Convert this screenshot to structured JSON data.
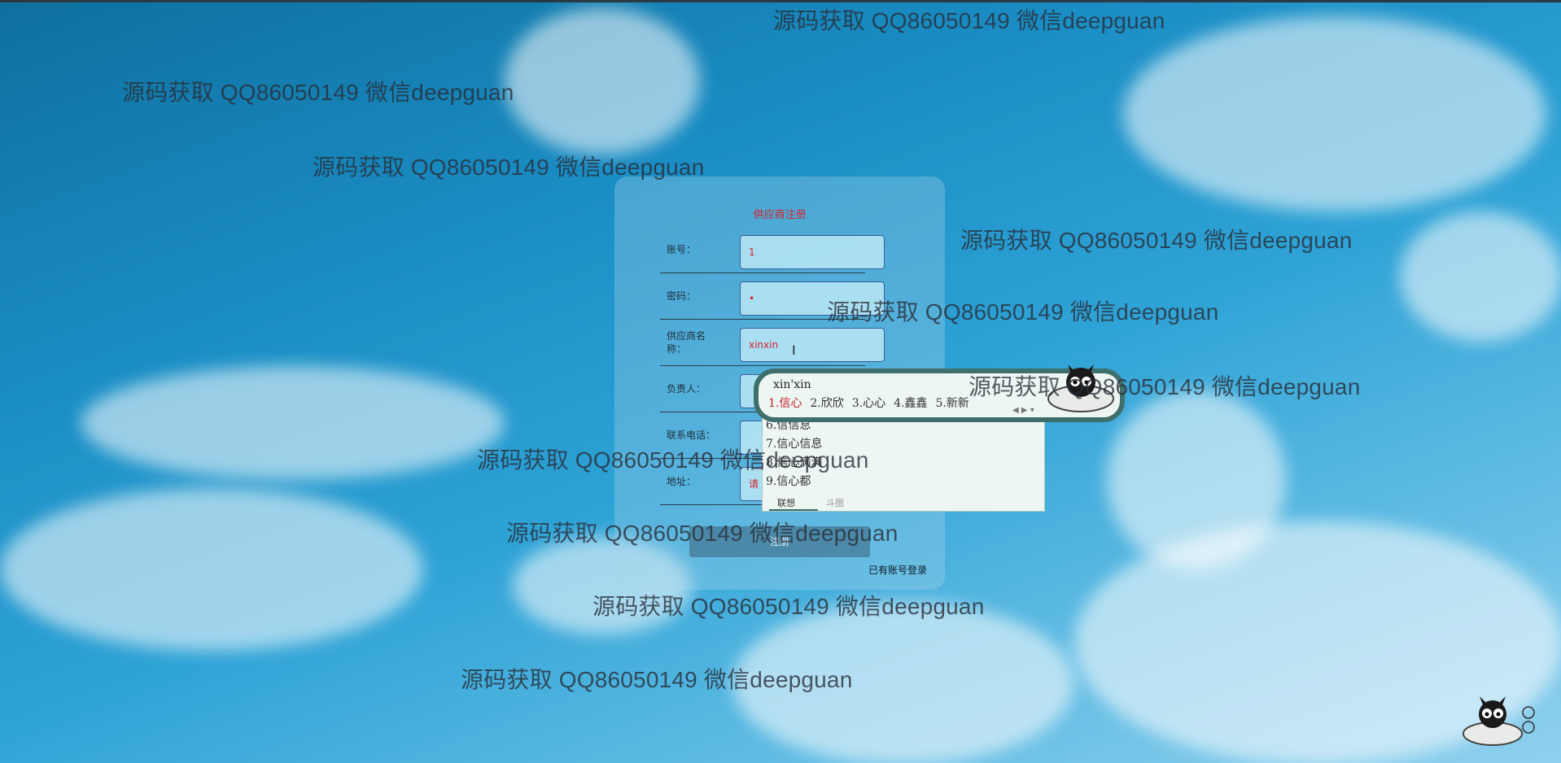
{
  "watermark_text": "源码获取 QQ86050149 微信deepguan",
  "form": {
    "title": "供应商注册",
    "fields": [
      {
        "label": "账号：",
        "value": "1"
      },
      {
        "label": "密码：",
        "value": "•"
      },
      {
        "label": "供应商名称：",
        "value": "xinxin"
      },
      {
        "label": "负责人：",
        "value": ""
      },
      {
        "label": "联系电话：",
        "value": ""
      },
      {
        "label": "地址：",
        "value": "请"
      }
    ],
    "register_button": "注册",
    "login_link": "已有账号登录"
  },
  "ime": {
    "pinyin": "xin'xin",
    "candidates": [
      "1.信心",
      "2.欣欣",
      "3.心心",
      "4.鑫鑫",
      "5.新新"
    ],
    "more": [
      "6.信信息",
      "7.信心信息",
      "8.信心满满",
      "9.信心都"
    ],
    "tabs": [
      "联想",
      "斗图"
    ]
  },
  "colors": {
    "title": "#d8202c",
    "accent": "#3f6f6a"
  }
}
